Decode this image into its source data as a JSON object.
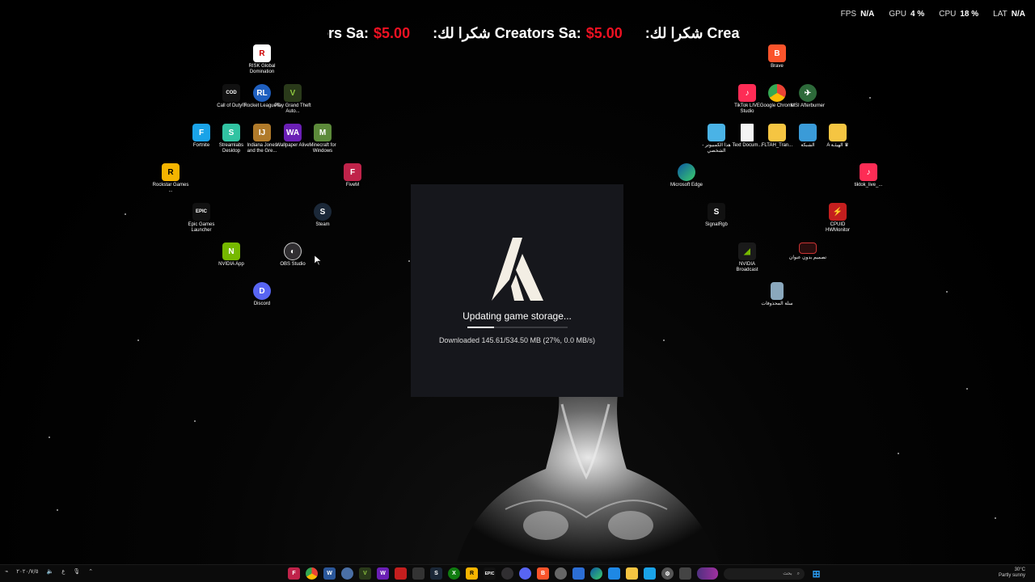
{
  "ticker": {
    "items": [
      {
        "text": "ors Sa:",
        "price": "$5.00"
      },
      {
        "text": ":شكرا لك Creators Sa:",
        "price": "$5.00"
      },
      {
        "text": ":شكرا لك Creato",
        "price": ""
      }
    ]
  },
  "perf": {
    "fps_label": "FPS",
    "fps_value": "N/A",
    "gpu_label": "GPU",
    "gpu_value": "4 %",
    "cpu_label": "CPU",
    "cpu_value": "18 %",
    "lat_label": "LAT",
    "lat_value": "N/A"
  },
  "desktop_icons": {
    "risk": "RISK Global Domination",
    "cod": "Call of Duty®",
    "rocket": "Rocket League®",
    "gta": "Play Grand Theft Auto...",
    "fortnite": "Fortnite",
    "streamlabs": "Streamlabs Desktop",
    "indiana": "Indiana Jones and the Gre...",
    "wallpaper": "Wallpaper Alive",
    "minecraft": "Minecraft for Windows",
    "fivem": "FiveM",
    "rockstar": "Rockstar Games ...",
    "epic": "Epic Games Launcher",
    "steam": "Steam",
    "nvidia_app": "NVIDIA App",
    "obs": "OBS Studio",
    "discord": "Discord",
    "brave": "Brave",
    "tiktok_live": "TikTok LIVE Studio",
    "chrome": "Google Chrome",
    "msi": "MSI Afterburner",
    "this_pc": "هذا الكمبيوتر - الشخصي",
    "text_doc": "Text Docum...",
    "fltah": "FLTAH_Tran...",
    "network": "الشبكة",
    "folder_a": "A الهيئـة ♛",
    "edge": "Microsoft Edge",
    "tiktok_short": "tiktok_live_...",
    "signalrgb": "SignalRgb",
    "cpuid": "CPUID HWMonitor",
    "nvidia_broadcast": "NVIDIA Broadcast",
    "untitled_design": "تصميم بدون عنوان",
    "recycle": "سلة المحذوفات"
  },
  "dialog": {
    "status": "Updating game storage...",
    "download": "Downloaded 145.61/534.50 MB (27%, 0.0 MB/s)",
    "progress": 0.27
  },
  "taskbar": {
    "left_time": "٢٠٢٠/٧/٥",
    "lang": "ع",
    "search_placeholder": "بحث",
    "weather_temp": "30°C",
    "weather_desc": "Partly sunny"
  },
  "colors": {
    "price": "#ee1122",
    "dialog_bg": "#16171c",
    "fivem": "#c0234a"
  }
}
